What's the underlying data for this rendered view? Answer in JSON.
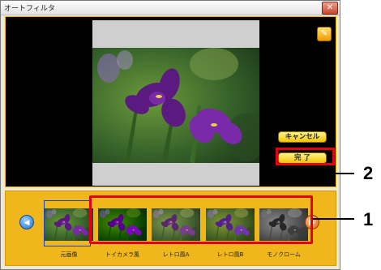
{
  "window": {
    "title": "オートフィルタ"
  },
  "buttons": {
    "cancel": "キャンセル",
    "done": "完 了",
    "close": "✕",
    "auto": "✎"
  },
  "thumbnails": [
    {
      "label": "元画像",
      "filter": "original"
    },
    {
      "label": "トイカメラ風",
      "filter": "toy"
    },
    {
      "label": "レトロ風A",
      "filter": "retroA"
    },
    {
      "label": "レトロ風B",
      "filter": "retroB"
    },
    {
      "label": "モノクローム",
      "filter": "mono"
    }
  ],
  "nav": {
    "prev": "◀",
    "next": "▶"
  },
  "callouts": {
    "one": "1",
    "two": "2"
  },
  "colors": {
    "accent": "#f0b71d",
    "highlight": "#e00012"
  }
}
